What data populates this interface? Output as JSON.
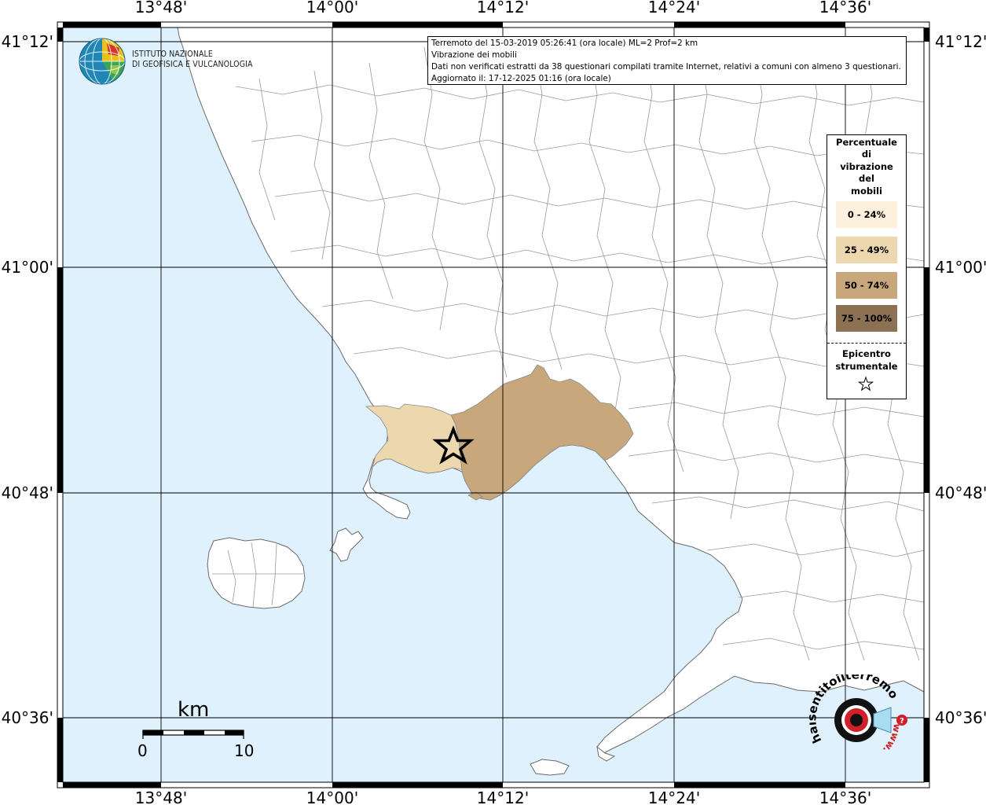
{
  "map": {
    "top_ticks": [
      "13°48'",
      "14°00'",
      "14°12'",
      "14°24'",
      "14°36'"
    ],
    "bottom_ticks": [
      "13°48'",
      "14°00'",
      "14°12'",
      "14°24'",
      "14°36'"
    ],
    "left_ticks": [
      "41°12'",
      "41°00'",
      "40°48'",
      "40°36'"
    ],
    "right_ticks": [
      "41°12'",
      "41°00'",
      "40°48'",
      "40°36'"
    ],
    "colors": {
      "sea": "#dff1fc",
      "land": "#ffffff",
      "border": "#9a9a9a",
      "grid": "#000000"
    }
  },
  "logo": {
    "line1": "ISTITUTO NAZIONALE",
    "line2": "DI GEOFISICA E VULCANOLOGIA"
  },
  "info": {
    "line1": "Terremoto del 15-03-2019 05:26:41 (ora locale) ML=2 Prof=2 km",
    "line2": "Vibrazione dei mobili",
    "line3": "Dati non verificati estratti da 38 questionari compilati tramite Internet, relativi a comuni con almeno 3 questionari.",
    "line4": "Aggiornato il: 17-12-2025 01:16 (ora locale)"
  },
  "legend": {
    "title": [
      "Percentuale",
      "di",
      "vibrazione",
      "del",
      "mobili"
    ],
    "classes": [
      {
        "label": "0 - 24%",
        "color": "#fdf0dc"
      },
      {
        "label": "25 - 49%",
        "color": "#ecd7af"
      },
      {
        "label": "50 - 74%",
        "color": "#c8a77c"
      },
      {
        "label": "75 - 100%",
        "color": "#8c7153"
      }
    ],
    "epicenter_label": [
      "Epicentro",
      "strumentale"
    ]
  },
  "scale": {
    "unit": "km",
    "min": "0",
    "max": "10"
  },
  "hst": {
    "url_text": "haisentitoilterremoto.it",
    "www": "www."
  }
}
